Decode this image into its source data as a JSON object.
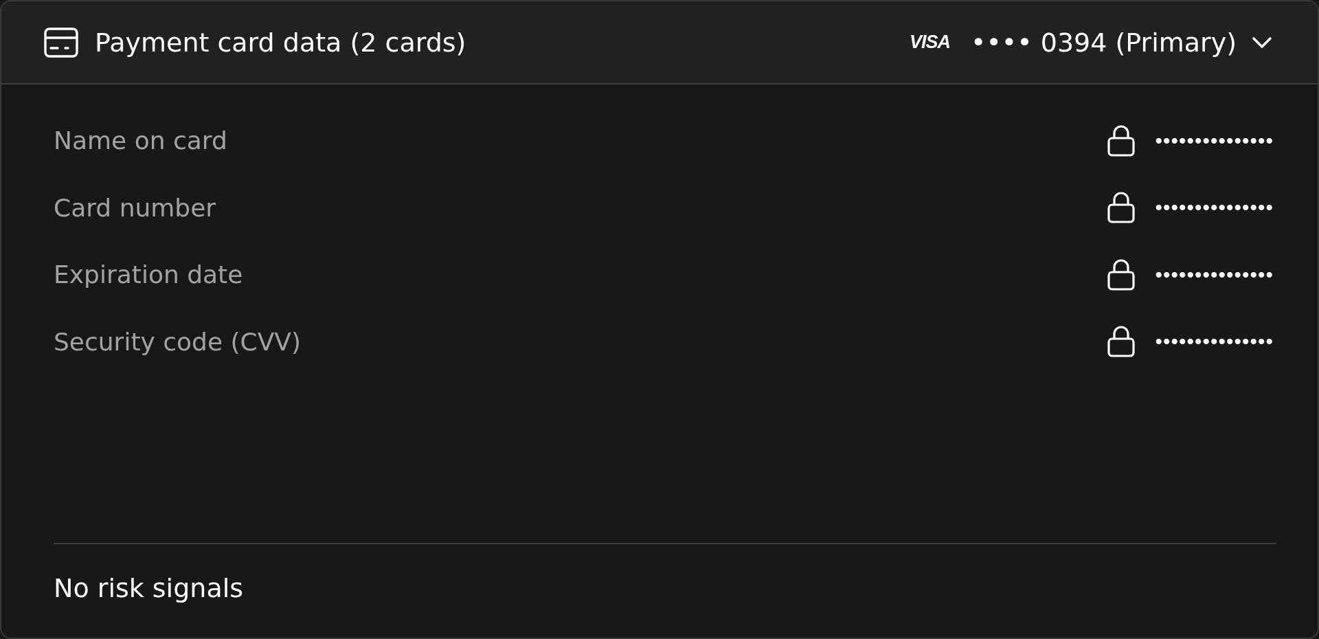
{
  "panel": {
    "title": "Payment card data (2 cards)",
    "card_selector": {
      "brand": "VISA",
      "label": "•••• 0394 (Primary)"
    },
    "fields": [
      {
        "label": "Name on card",
        "value": "•••••••••••••••",
        "locked": true
      },
      {
        "label": "Card number",
        "value": "•••••••••••••••",
        "locked": true
      },
      {
        "label": "Expiration date",
        "value": "•••••••••••••••",
        "locked": true
      },
      {
        "label": "Security code (CVV)",
        "value": "•••••••••••••••",
        "locked": true
      }
    ],
    "footer": "No risk signals"
  }
}
